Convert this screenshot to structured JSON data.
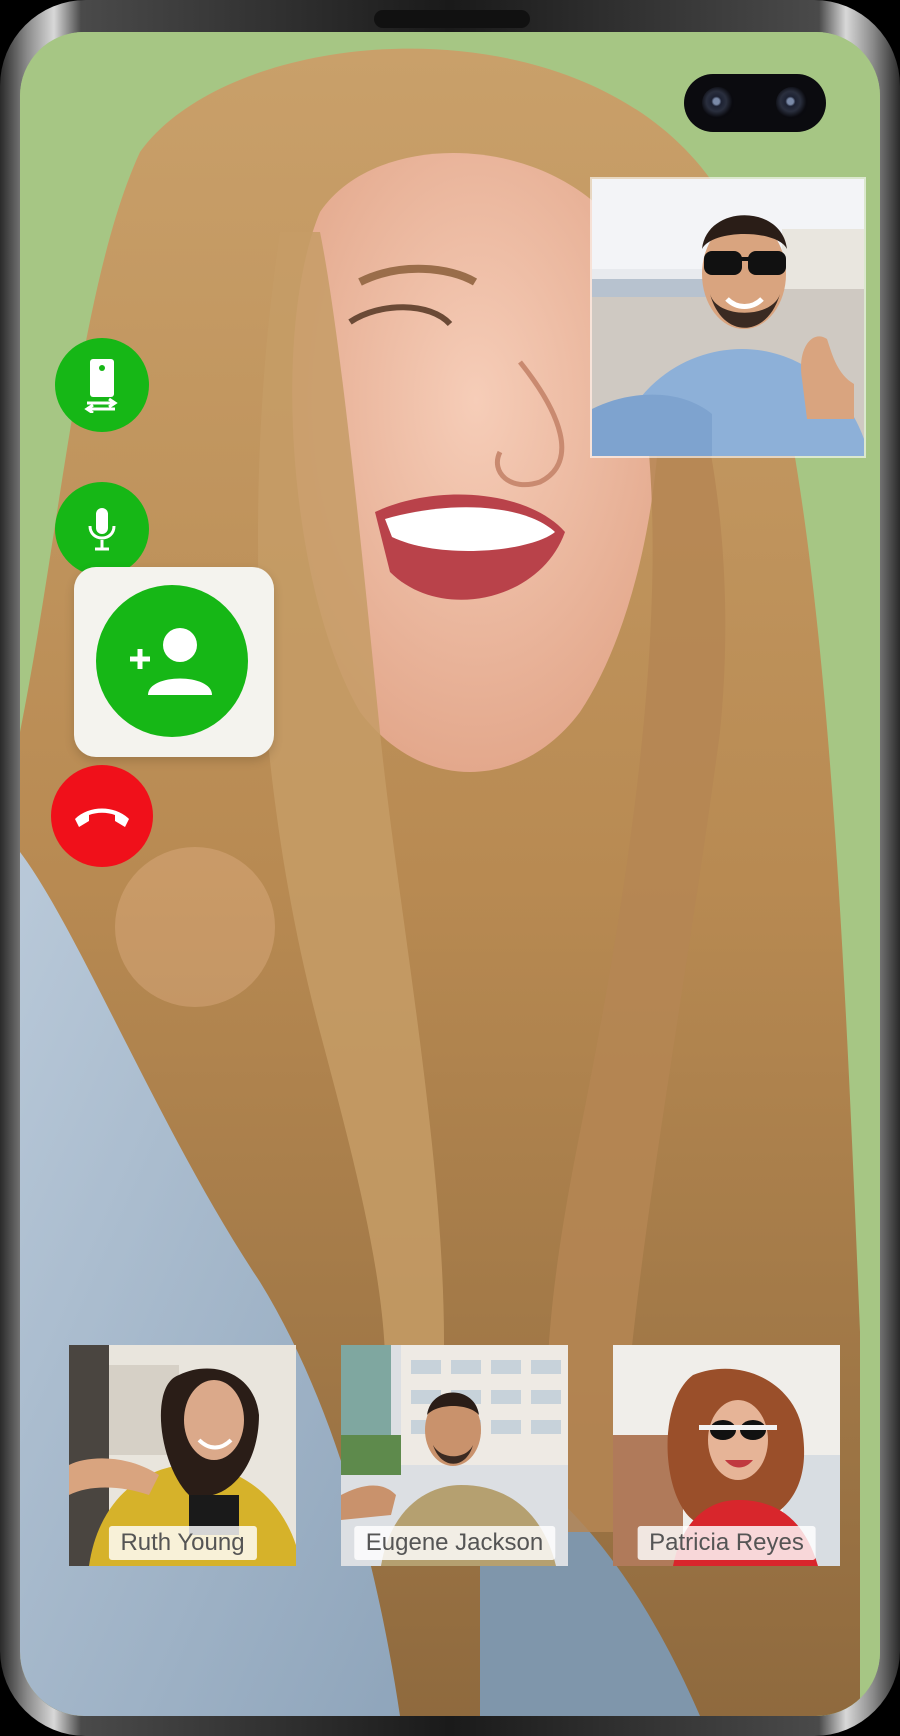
{
  "call": {
    "participants": [
      {
        "name": "Ruth Young"
      },
      {
        "name": "Eugene Jackson"
      },
      {
        "name": "Patricia Reyes"
      }
    ]
  },
  "controls": {
    "switch_camera_icon": "switch-camera-icon",
    "mic_icon": "microphone-icon",
    "add_person_icon": "add-person-icon",
    "end_call_icon": "end-call-icon"
  },
  "colors": {
    "accent_green": "#16b716",
    "end_call_red": "#f0101a",
    "background_green": "#9ec07a"
  }
}
